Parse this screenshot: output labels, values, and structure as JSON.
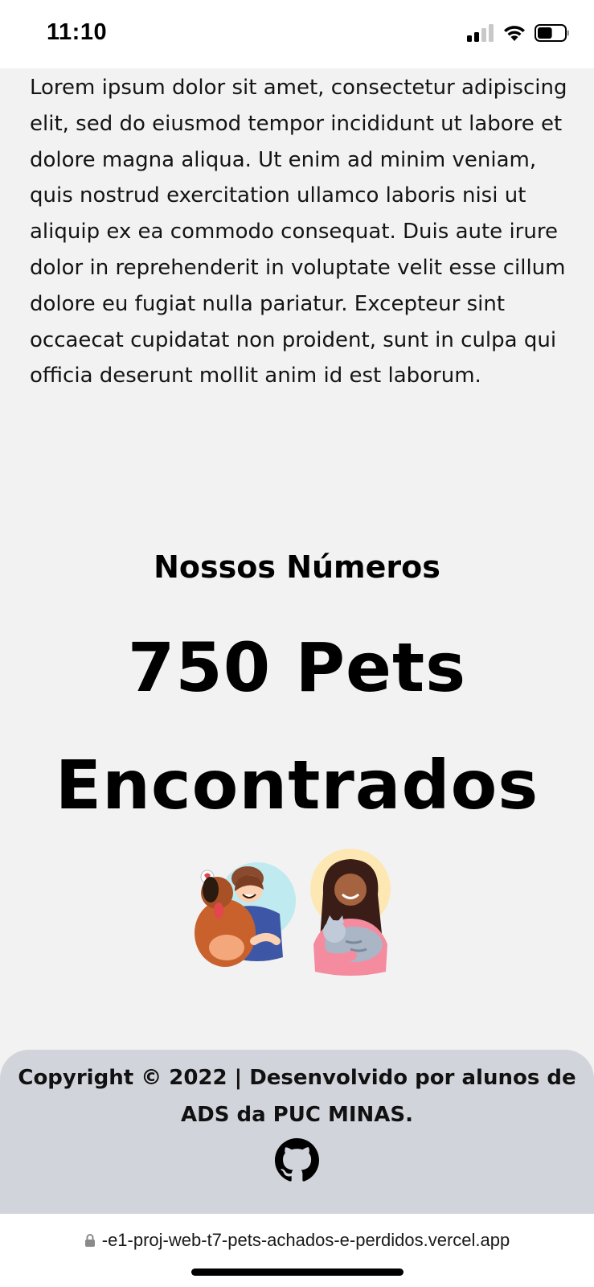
{
  "status_bar": {
    "time": "11:10",
    "battery_level": 0.55
  },
  "intro_text": "Lorem ipsum dolor sit amet, consectetur adipiscing elit, sed do eiusmod tempor incididunt ut labore et dolore magna aliqua. Ut enim ad minim veniam, quis nostrud exercitation ullamco laboris nisi ut aliquip ex ea commodo consequat. Duis aute irure dolor in reprehenderit in voluptate velit esse cillum dolore eu fugiat nulla pariatur. Excepteur sint occaecat cupidatat non proident, sunt in culpa qui officia deserunt mollit anim id est laborum.",
  "numbers": {
    "heading": "Nossos Números",
    "value": "750 Pets Encontrados"
  },
  "illustration": {
    "icons": [
      "man-with-dog-icon",
      "woman-with-cat-icon"
    ]
  },
  "footer": {
    "copyright": "Copyright © 2022 | Desenvolvido por alunos de ADS da PUC MINAS.",
    "icon": "github-icon"
  },
  "browser": {
    "url": "-e1-proj-web-t7-pets-achados-e-perdidos.vercel.app"
  },
  "colors": {
    "page_background": "#f2f2f2",
    "footer_background": "#d1d5db"
  }
}
